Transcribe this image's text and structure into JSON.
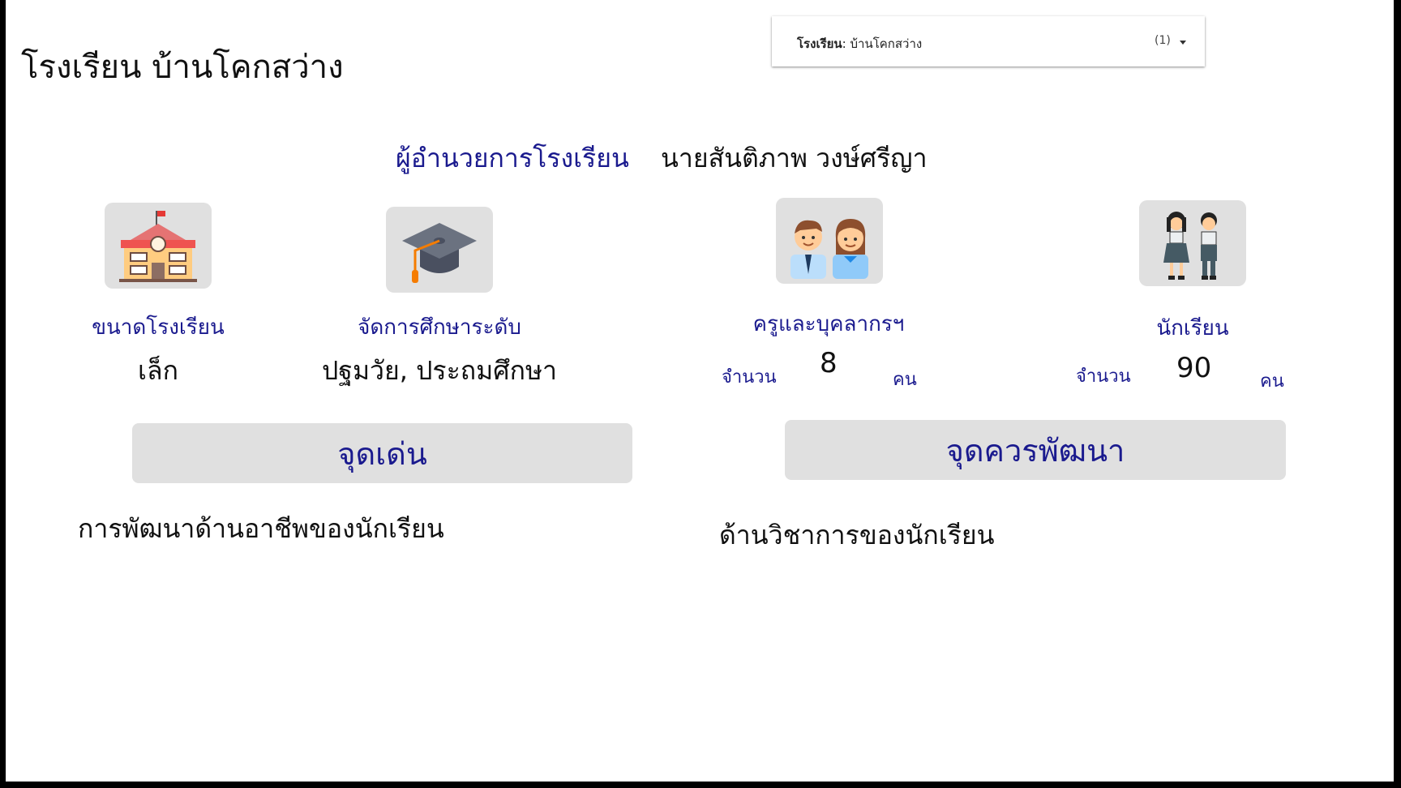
{
  "header": {
    "school_title": "โรงเรียน บ้านโคกสว่าง"
  },
  "filter": {
    "label_bold": "โรงเรียน",
    "label_value": ": บ้านโคกสว่าง",
    "count": "(1)"
  },
  "director": {
    "label": "ผู้อำนวยการโรงเรียน",
    "name": "นายสันติภาพ วงษ์ศรีญา"
  },
  "cards": {
    "school_size": {
      "label": "ขนาดโรงเรียน",
      "value": "เล็ก",
      "icon": "school-building-icon"
    },
    "education_level": {
      "label": "จัดการศึกษาระดับ",
      "value": "ปฐมวัย, ประถมศึกษา",
      "icon": "graduation-cap-icon"
    },
    "teachers": {
      "label": "ครูและบุคลากรฯ",
      "count_label": "จำนวน",
      "count": "8",
      "unit": "คน",
      "icon": "teachers-icon"
    },
    "students": {
      "label": "นักเรียน",
      "count_label": "จำนวน",
      "count": "90",
      "unit": "คน",
      "icon": "students-icon"
    }
  },
  "sections": {
    "strengths": {
      "title": "จุดเด่น",
      "text": "การพัฒนาด้านอาชีพของนักเรียน"
    },
    "improvements": {
      "title": "จุดควรพัฒนา",
      "text": "ด้านวิชาการของนักเรียน"
    }
  },
  "colors": {
    "accent_blue": "#1a1a8e",
    "panel_gray": "#e0e0e0"
  }
}
